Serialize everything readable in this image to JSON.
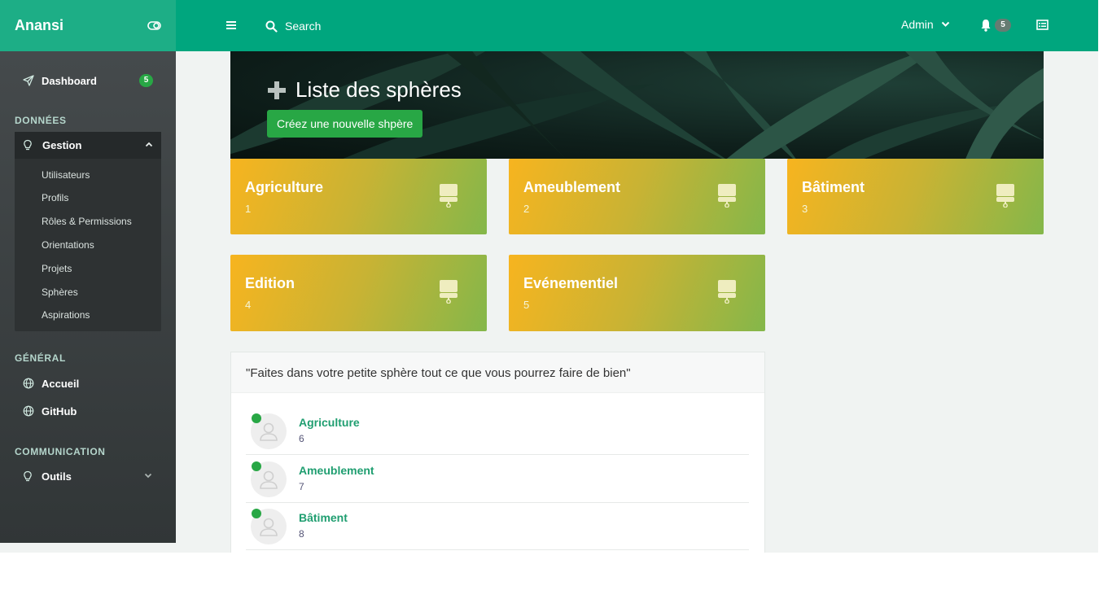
{
  "topbar": {
    "brand": "Anansi",
    "search_label": "Search",
    "user_label": "Admin",
    "notification_count": "5",
    "color_primary": "#00a67e"
  },
  "sidebar": {
    "dashboard_label": "Dashboard",
    "dashboard_badge": "5",
    "sections": {
      "data": "DONNÉES",
      "general": "GÉNÉRAL",
      "communication": "COMMUNICATION"
    },
    "gestion_label": "Gestion",
    "gestion_items": [
      "Utilisateurs",
      "Profils",
      "Rôles & Permissions",
      "Orientations",
      "Projets",
      "Sphères",
      "Aspirations"
    ],
    "general_items": [
      "Accueil",
      "GitHub"
    ],
    "outils_label": "Outils"
  },
  "banner": {
    "title": "Liste des sphères",
    "create_button": "Créez une nouvelle shpère"
  },
  "cards": [
    {
      "title": "Agriculture",
      "count": "1"
    },
    {
      "title": "Ameublement",
      "count": "2"
    },
    {
      "title": "Bâtiment",
      "count": "3"
    },
    {
      "title": "Edition",
      "count": "4"
    },
    {
      "title": "Evénementiel",
      "count": "5"
    }
  ],
  "panel": {
    "quote": "\"Faites dans votre petite sphère tout ce que vous pourrez faire de bien\"",
    "rows": [
      {
        "name": "Agriculture",
        "count": "6"
      },
      {
        "name": "Ameublement",
        "count": "7"
      },
      {
        "name": "Bâtiment",
        "count": "8"
      }
    ]
  }
}
